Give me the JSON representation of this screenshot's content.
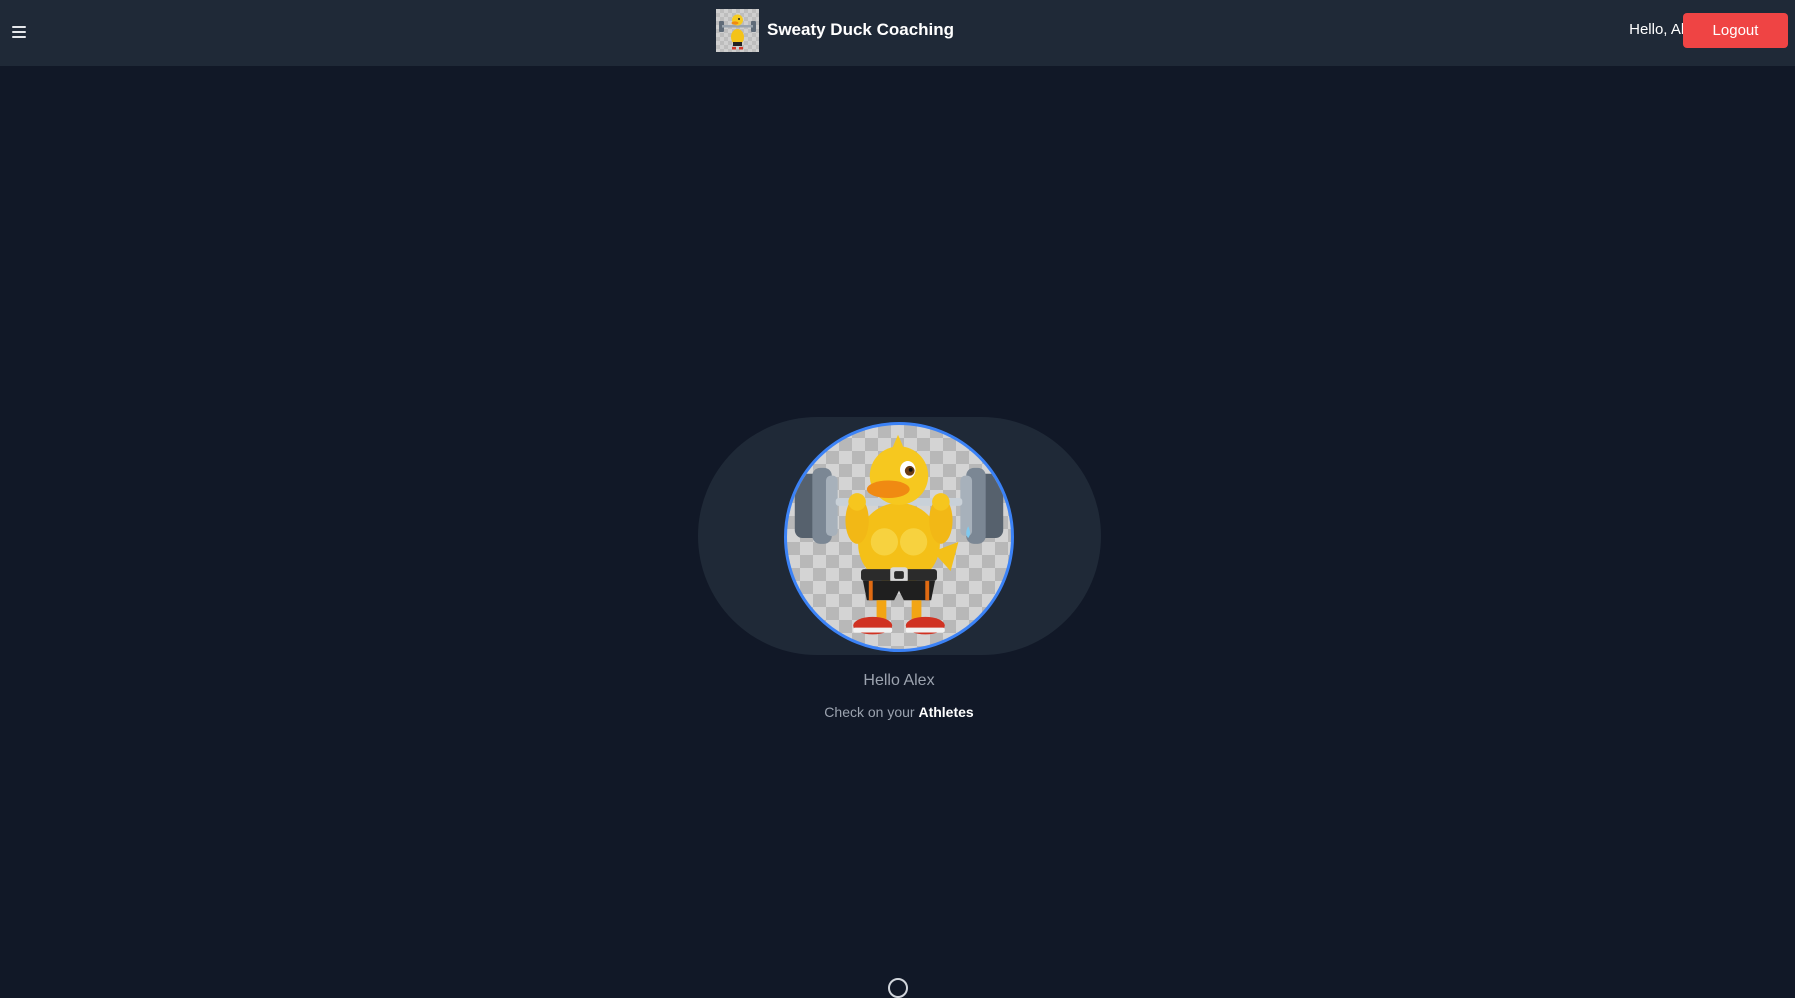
{
  "header": {
    "brand_name": "Sweaty Duck Coaching",
    "brand_logo_icon": "weightlifting-duck-logo",
    "greeting": "Hello, Alex",
    "logout_label": "Logout",
    "menu_icon": "hamburger-menu-icon"
  },
  "hero": {
    "avatar_icon": "weightlifting-duck-mascot",
    "greeting": "Hello Alex",
    "prompt_text": "Check on your",
    "athletes_link": "Athletes"
  },
  "colors": {
    "background": "#111827",
    "header_bg": "#1f2937",
    "logout": "#ef4444",
    "avatar_border": "#3b82f6"
  }
}
